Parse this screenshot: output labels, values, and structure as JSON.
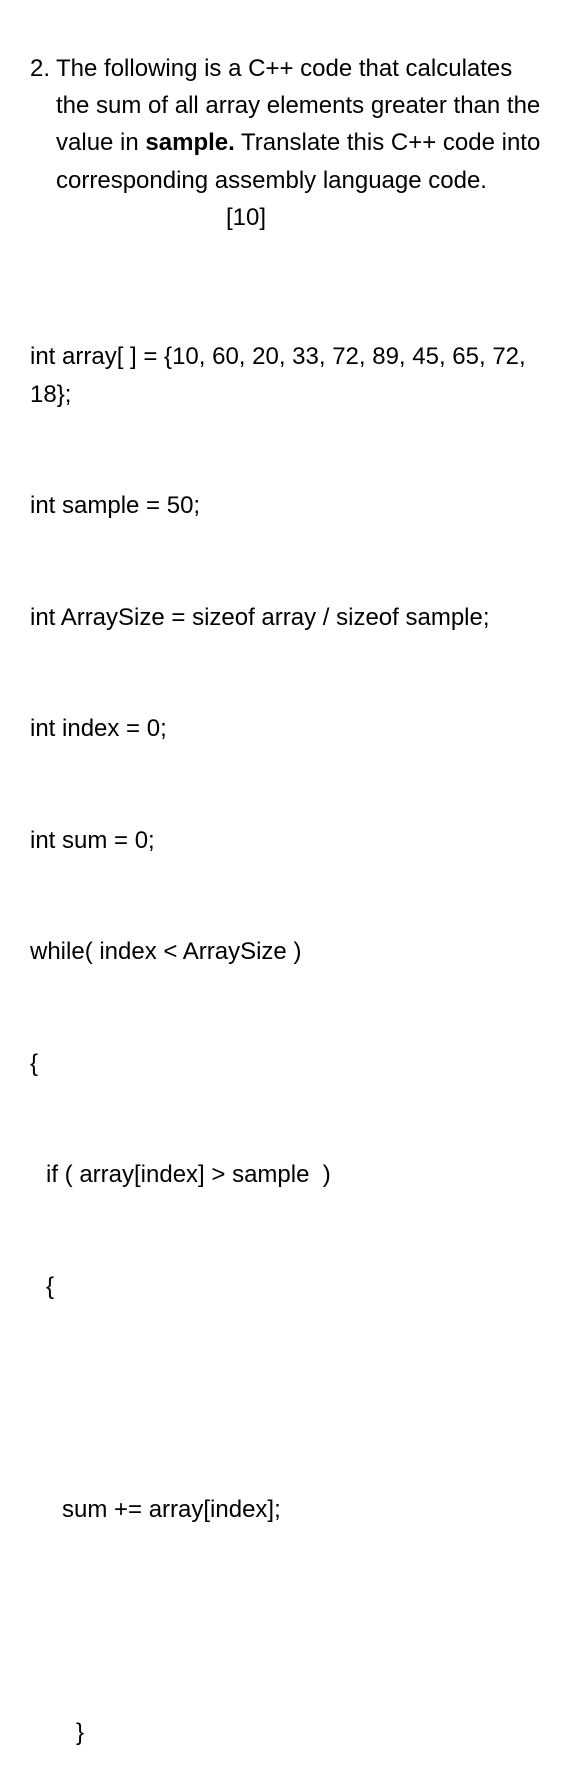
{
  "question": {
    "number": "2.",
    "text_part1": "The following is a C++ code that calculates the sum of all array elements greater than the value in ",
    "bold_word": "sample.",
    "text_part2": " Translate this C++ code into corresponding assembly language code.",
    "marks": "[10]"
  },
  "code": {
    "line1": "int array[ ] = {10, 60, 20, 33, 72, 89, 45, 65, 72, 18};",
    "line2": "int sample = 50;",
    "line3": "int ArraySize = sizeof array / sizeof sample;",
    "line4": "int index = 0;",
    "line5": "int sum = 0;",
    "line6": "while( index < ArraySize )",
    "line7": "{",
    "line8": "if ( array[index] > sample  )",
    "line9": "{",
    "line10": "sum += array[index];",
    "line11": "}"
  }
}
